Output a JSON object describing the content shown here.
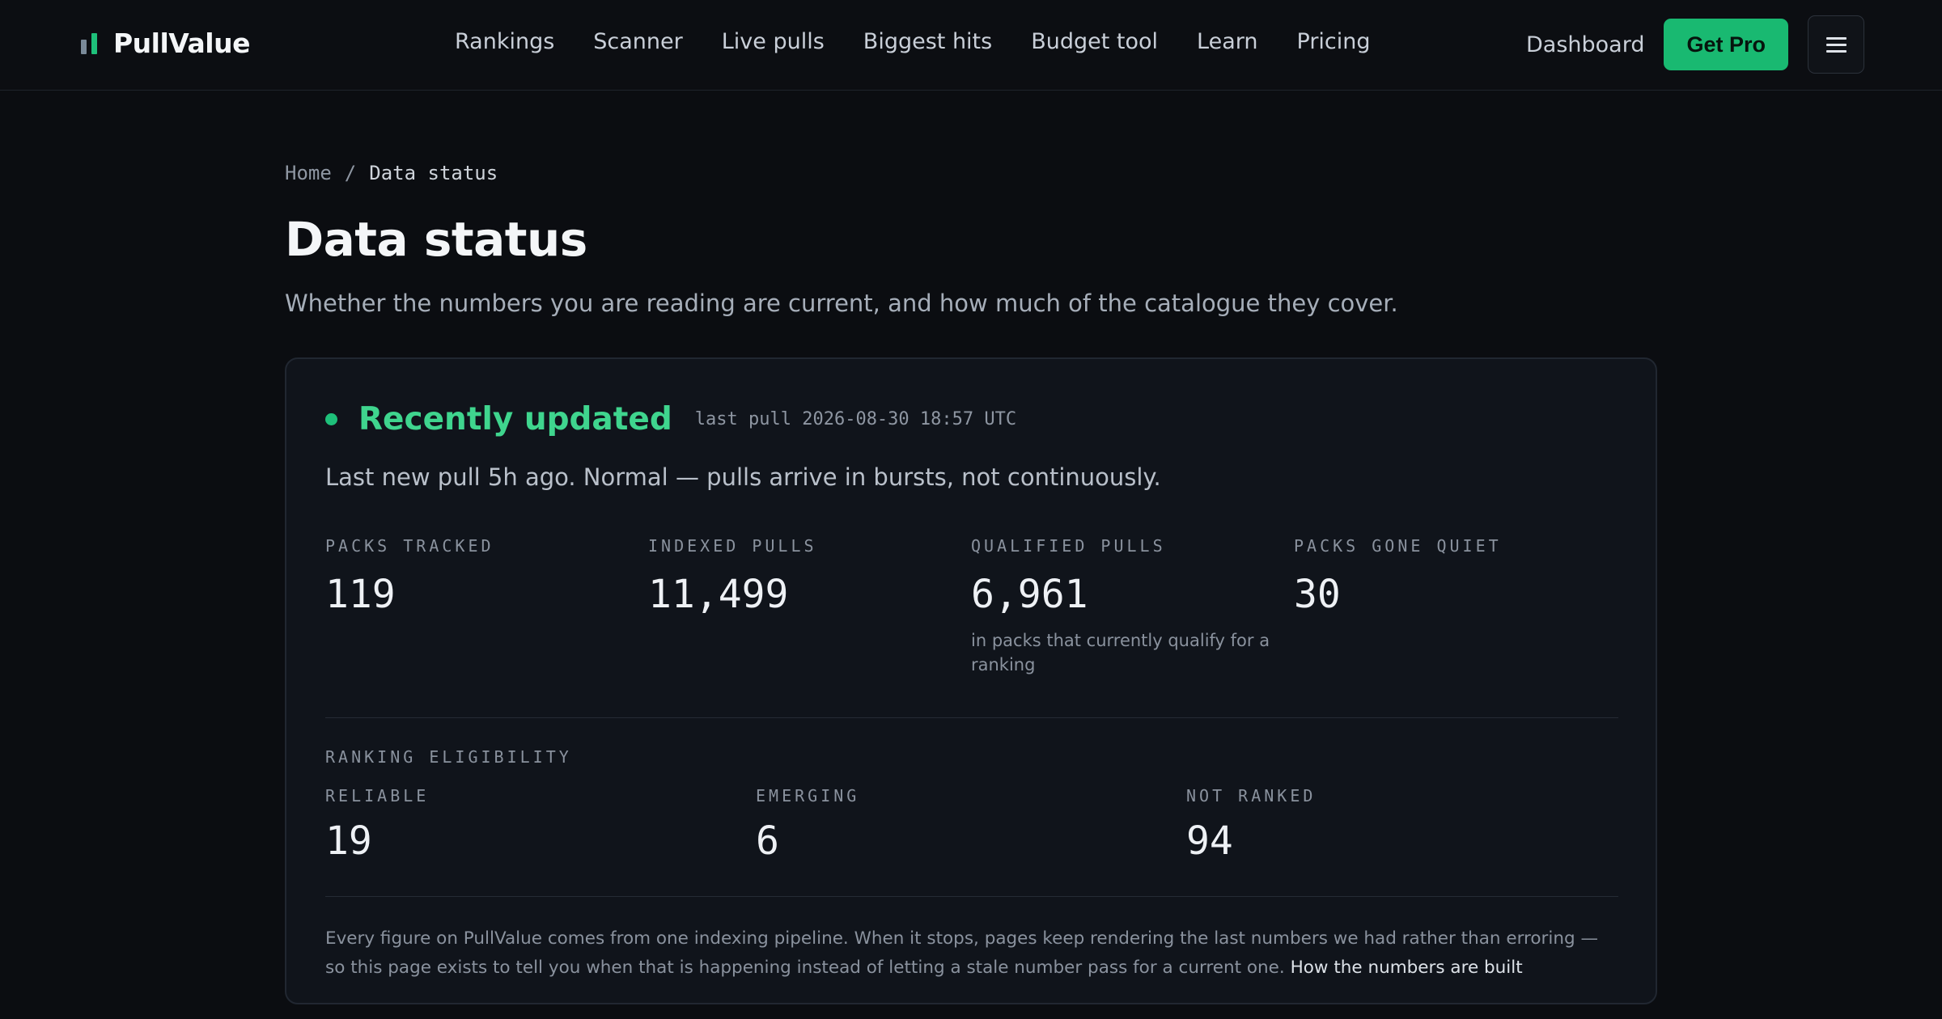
{
  "brand": {
    "name": "PullValue"
  },
  "nav": {
    "items": [
      "Rankings",
      "Scanner",
      "Live pulls",
      "Biggest hits",
      "Budget tool",
      "Learn",
      "Pricing"
    ]
  },
  "header": {
    "dashboard_label": "Dashboard",
    "pro_label": "Get Pro",
    "menu_icon": "hamburger-menu-icon"
  },
  "breadcrumb": {
    "home": "Home",
    "separator": "/",
    "current": "Data status"
  },
  "page": {
    "title": "Data status",
    "subtitle": "Whether the numbers you are reading are current, and how much of the catalogue they cover."
  },
  "status": {
    "title": "Recently updated",
    "last_pull": "last pull 2026-08-30 18:57 UTC",
    "note": "Last new pull 5h ago. Normal — pulls arrive in bursts, not continuously.",
    "color": "#1ec07a"
  },
  "stats": [
    {
      "label": "PACKS TRACKED",
      "value": "119",
      "note": ""
    },
    {
      "label": "INDEXED PULLS",
      "value": "11,499",
      "note": ""
    },
    {
      "label": "QUALIFIED PULLS",
      "value": "6,961",
      "note": "in packs that currently qualify for a ranking"
    },
    {
      "label": "PACKS GONE QUIET",
      "value": "30",
      "note": ""
    }
  ],
  "eligibility": {
    "title": "RANKING ELIGIBILITY",
    "items": [
      {
        "label": "RELIABLE",
        "value": "19"
      },
      {
        "label": "EMERGING",
        "value": "6"
      },
      {
        "label": "NOT RANKED",
        "value": "94"
      }
    ]
  },
  "footnote": {
    "text": "Every figure on PullValue comes from one indexing pipeline. When it stops, pages keep rendering the last numbers we had rather than erroring — so this page exists to tell you when that is happening instead of letting a stale number pass for a current one.",
    "link": "How the numbers are built"
  },
  "colors": {
    "accent": "#19b971",
    "background": "#0b0d11",
    "card": "#10141b"
  }
}
